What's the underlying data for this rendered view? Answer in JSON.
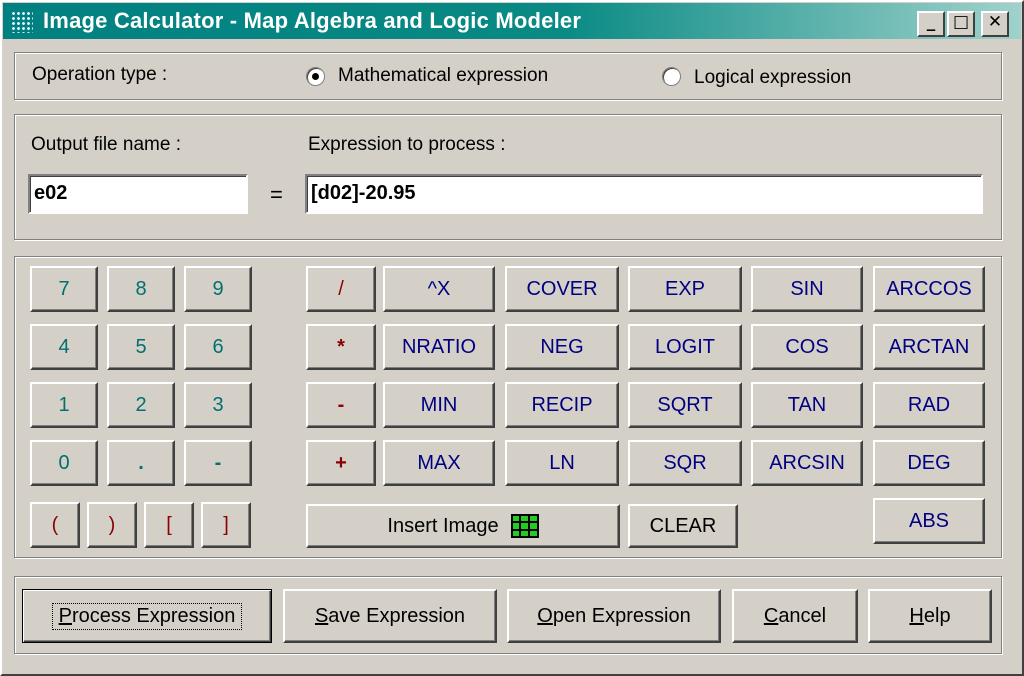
{
  "window": {
    "title": "Image Calculator - Map  Algebra and Logic Modeler",
    "minimize_glyph": "_",
    "maximize_glyph": "□",
    "close_glyph": "✕"
  },
  "operation": {
    "label": "Operation type :",
    "options": [
      {
        "label": "Mathematical expression",
        "selected": true
      },
      {
        "label": "Logical expression",
        "selected": false
      }
    ]
  },
  "expression": {
    "output_label": "Output file name :",
    "output_value": "e02",
    "equals": "=",
    "expression_label": "Expression to process :",
    "expression_value": "[d02]-20.95"
  },
  "keypad": {
    "digits": [
      "7",
      "8",
      "9",
      "4",
      "5",
      "6",
      "1",
      "2",
      "3",
      "0",
      ".",
      "-"
    ],
    "brackets": [
      "(",
      ")",
      "[",
      "]"
    ],
    "operators": [
      "/",
      "*",
      "-",
      "+"
    ],
    "functions": [
      [
        "^X",
        "COVER",
        "EXP",
        "SIN",
        "ARCCOS"
      ],
      [
        "NRATIO",
        "NEG",
        "LOGIT",
        "COS",
        "ARCTAN"
      ],
      [
        "MIN",
        "RECIP",
        "SQRT",
        "TAN",
        "RAD"
      ],
      [
        "MAX",
        "LN",
        "SQR",
        "ARCSIN",
        "DEG"
      ]
    ],
    "insert_image": "Insert Image",
    "clear": "CLEAR",
    "abs": "ABS"
  },
  "actions": {
    "process": {
      "first": "P",
      "rest": "rocess Expression"
    },
    "save": {
      "first": "S",
      "rest": "ave Expression"
    },
    "open": {
      "first": "O",
      "rest": "pen Expression"
    },
    "cancel": {
      "first": "C",
      "rest": "ancel"
    },
    "help": {
      "first": "H",
      "rest": "elp"
    }
  },
  "colors": {
    "title_bar": "#008080",
    "digit_text": "#007070",
    "function_text": "#000080",
    "operator_text": "#8b0000",
    "face": "#d4d0c8",
    "grid_icon": "#22cc22"
  }
}
